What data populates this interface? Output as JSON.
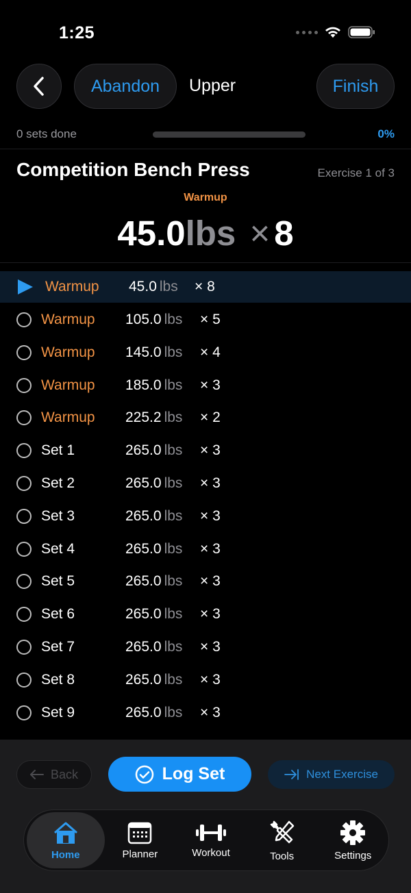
{
  "status": {
    "time": "1:25"
  },
  "header": {
    "abandon_label": "Abandon",
    "title": "Upper",
    "finish_label": "Finish"
  },
  "progress": {
    "sets_done_text": "0 sets done",
    "percent_text": "0%",
    "percent_value": 0
  },
  "exercise": {
    "name": "Competition Bench Press",
    "count_text": "Exercise 1 of 3",
    "current_type": "Warmup",
    "current_weight": "45.0",
    "current_unit": "lbs",
    "current_x": "×",
    "current_reps": "8"
  },
  "sets": [
    {
      "label": "Warmup",
      "weight": "45.0",
      "unit": "lbs",
      "reps": "× 8",
      "warmup": true,
      "active": true
    },
    {
      "label": "Warmup",
      "weight": "105.0",
      "unit": "lbs",
      "reps": "× 5",
      "warmup": true,
      "active": false
    },
    {
      "label": "Warmup",
      "weight": "145.0",
      "unit": "lbs",
      "reps": "× 4",
      "warmup": true,
      "active": false
    },
    {
      "label": "Warmup",
      "weight": "185.0",
      "unit": "lbs",
      "reps": "× 3",
      "warmup": true,
      "active": false
    },
    {
      "label": "Warmup",
      "weight": "225.2",
      "unit": "lbs",
      "reps": "× 2",
      "warmup": true,
      "active": false
    },
    {
      "label": "Set 1",
      "weight": "265.0",
      "unit": "lbs",
      "reps": "× 3",
      "warmup": false,
      "active": false
    },
    {
      "label": "Set 2",
      "weight": "265.0",
      "unit": "lbs",
      "reps": "× 3",
      "warmup": false,
      "active": false
    },
    {
      "label": "Set 3",
      "weight": "265.0",
      "unit": "lbs",
      "reps": "× 3",
      "warmup": false,
      "active": false
    },
    {
      "label": "Set 4",
      "weight": "265.0",
      "unit": "lbs",
      "reps": "× 3",
      "warmup": false,
      "active": false
    },
    {
      "label": "Set 5",
      "weight": "265.0",
      "unit": "lbs",
      "reps": "× 3",
      "warmup": false,
      "active": false
    },
    {
      "label": "Set 6",
      "weight": "265.0",
      "unit": "lbs",
      "reps": "× 3",
      "warmup": false,
      "active": false
    },
    {
      "label": "Set 7",
      "weight": "265.0",
      "unit": "lbs",
      "reps": "× 3",
      "warmup": false,
      "active": false
    },
    {
      "label": "Set 8",
      "weight": "265.0",
      "unit": "lbs",
      "reps": "× 3",
      "warmup": false,
      "active": false
    },
    {
      "label": "Set 9",
      "weight": "265.0",
      "unit": "lbs",
      "reps": "× 3",
      "warmup": false,
      "active": false
    }
  ],
  "actions": {
    "back_label": "Back",
    "log_label": "Log Set",
    "next_label": "Next Exercise"
  },
  "tabs": [
    {
      "label": "Home",
      "icon": "home-icon",
      "active": true
    },
    {
      "label": "Planner",
      "icon": "calendar-icon",
      "active": false
    },
    {
      "label": "Workout",
      "icon": "dumbbell-icon",
      "active": false
    },
    {
      "label": "Tools",
      "icon": "tools-icon",
      "active": false
    },
    {
      "label": "Settings",
      "icon": "gear-icon",
      "active": false
    }
  ],
  "colors": {
    "accent": "#2e9bf0",
    "warmup": "#f29345",
    "background": "#000000"
  }
}
